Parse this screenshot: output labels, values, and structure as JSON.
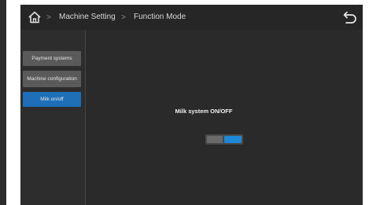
{
  "header": {
    "breadcrumb": [
      {
        "label": "Machine Setting"
      },
      {
        "label": "Function Mode"
      }
    ],
    "separator": ">",
    "home_icon": "home-icon",
    "back_icon": "back-arrow-icon"
  },
  "sidebar": {
    "items": [
      {
        "label": "Payment systems",
        "active": false
      },
      {
        "label": "Machine configuration",
        "active": false
      },
      {
        "label": "Milk on/off",
        "active": true
      }
    ]
  },
  "main": {
    "setting_label": "Milk system ON/OFF",
    "toggle_state": "on"
  },
  "colors": {
    "accent": "#1e6fb8",
    "toggle_on": "#1e88d8",
    "background": "#2a2a2a",
    "button": "#5a5a5a"
  }
}
